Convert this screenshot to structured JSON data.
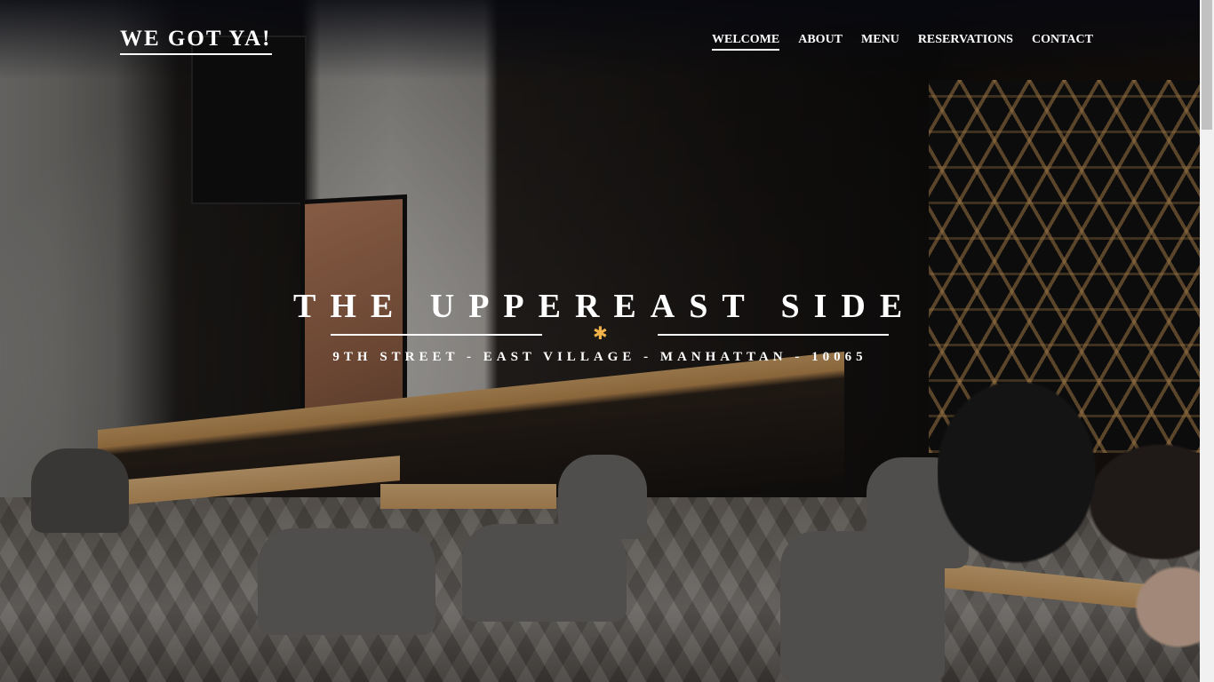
{
  "brand": {
    "name": "WE GOT YA!"
  },
  "nav": {
    "items": [
      {
        "label": "WELCOME",
        "active": true
      },
      {
        "label": "ABOUT",
        "active": false
      },
      {
        "label": "MENU",
        "active": false
      },
      {
        "label": "RESERVATIONS",
        "active": false
      },
      {
        "label": "CONTACT",
        "active": false
      }
    ]
  },
  "hero": {
    "title": "THE UPPEREAST SIDE",
    "subtitle": "9TH STREET - EAST VILLAGE - MANHATTAN - 10065",
    "divider_icon": "asterisk-ornament-icon",
    "accent_color": "#f2b24a"
  },
  "scrollbar": {
    "icon": "vertical-scrollbar"
  }
}
